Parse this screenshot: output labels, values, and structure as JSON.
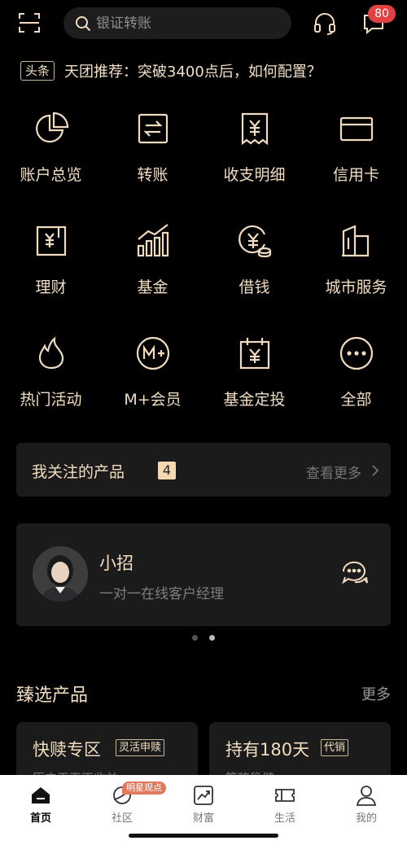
{
  "header": {
    "search_placeholder": "银证转账",
    "message_badge": "80",
    "icons": [
      "scan-icon",
      "search-icon",
      "headset-icon",
      "message-icon"
    ]
  },
  "news": {
    "tag": "头条",
    "headline": "天团推荐：突破3400点后，如何配置？"
  },
  "grid": [
    {
      "label": "账户总览",
      "icon": "pie-chart-icon"
    },
    {
      "label": "转账",
      "icon": "transfer-icon"
    },
    {
      "label": "收支明细",
      "icon": "receipt-icon"
    },
    {
      "label": "信用卡",
      "icon": "credit-card-icon"
    },
    {
      "label": "理财",
      "icon": "wealth-doc-icon"
    },
    {
      "label": "基金",
      "icon": "fund-chart-icon"
    },
    {
      "label": "借钱",
      "icon": "loan-coin-icon"
    },
    {
      "label": "城市服务",
      "icon": "city-building-icon"
    },
    {
      "label": "热门活动",
      "icon": "flame-icon"
    },
    {
      "label": "M+会员",
      "icon": "member-icon"
    },
    {
      "label": "基金定投",
      "icon": "calendar-yen-icon"
    },
    {
      "label": "全部",
      "icon": "more-dots-icon"
    }
  ],
  "follow": {
    "title": "我关注的产品",
    "count": "4",
    "more": "查看更多"
  },
  "manager": {
    "name": "小招",
    "desc": "一对一在线客户经理"
  },
  "featured": {
    "title": "臻选产品",
    "more": "更多",
    "cards": [
      {
        "title": "快赎专区",
        "tag": "灵活申赎",
        "subtitle": "历史天天正收益"
      },
      {
        "title": "持有180天",
        "tag": "代销",
        "subtitle": "策略稳健"
      }
    ]
  },
  "tabbar": {
    "items": [
      {
        "label": "首页",
        "icon": "home-icon",
        "active": true
      },
      {
        "label": "社区",
        "icon": "community-icon",
        "active": false
      },
      {
        "label": "财富",
        "icon": "wealth-chart-icon",
        "active": false
      },
      {
        "label": "生活",
        "icon": "ticket-icon",
        "active": false
      },
      {
        "label": "我的",
        "icon": "profile-icon",
        "active": false
      }
    ],
    "community_badge": "明星观点"
  },
  "colors": {
    "background": "#000000",
    "accent": "#f1dcc0",
    "badge": "#e24141",
    "card": "#1b1b1b"
  }
}
